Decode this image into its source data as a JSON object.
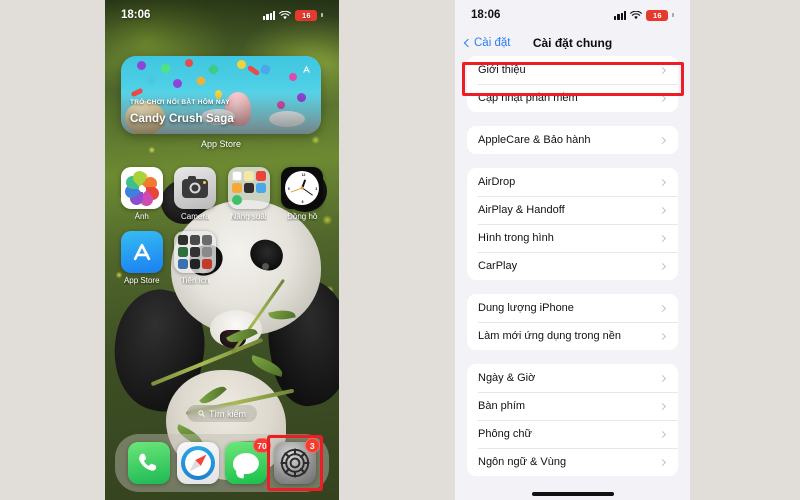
{
  "left_phone": {
    "status_bar": {
      "time": "18:06",
      "battery": "16",
      "signal_icon": "cellular-bars-icon",
      "wifi_icon": "wifi-icon"
    },
    "widget": {
      "eyebrow": "TRÒ CHƠI NỔI BẬT HÔM NAY",
      "title": "Candy Crush Saga",
      "caption": "App Store",
      "store_icon": "app-store-icon"
    },
    "apps": [
      {
        "label": "Ảnh",
        "icon": "photos-icon"
      },
      {
        "label": "Camera",
        "icon": "camera-icon"
      },
      {
        "label": "Năng suất",
        "icon": "folder-icon"
      },
      {
        "label": "Đồng hồ",
        "icon": "clock-icon"
      },
      {
        "label": "App Store",
        "icon": "app-store-icon"
      },
      {
        "label": "Tiện ích",
        "icon": "folder-icon"
      }
    ],
    "search": {
      "label": "Tìm kiếm",
      "icon": "search-icon"
    },
    "dock": [
      {
        "name": "phone",
        "icon": "phone-icon",
        "badge": ""
      },
      {
        "name": "safari",
        "icon": "safari-icon",
        "badge": ""
      },
      {
        "name": "messages",
        "icon": "messages-icon",
        "badge": "70"
      },
      {
        "name": "settings",
        "icon": "settings-gear-icon",
        "badge": "3",
        "highlighted": true
      }
    ]
  },
  "right_phone": {
    "status_bar": {
      "time": "18:06",
      "battery": "16",
      "signal_icon": "cellular-bars-icon",
      "wifi_icon": "wifi-icon"
    },
    "nav": {
      "back_label": "Cài đặt",
      "back_icon": "chevron-left-icon",
      "title": "Cài đặt chung"
    },
    "groups": [
      {
        "rows": [
          {
            "label": "Giới thiệu",
            "highlighted": true
          },
          {
            "label": "Cập nhật phần mềm",
            "highlighted": false
          }
        ]
      },
      {
        "rows": [
          {
            "label": "AppleCare & Bảo hành",
            "highlighted": false
          }
        ]
      },
      {
        "rows": [
          {
            "label": "AirDrop",
            "highlighted": false
          },
          {
            "label": "AirPlay & Handoff",
            "highlighted": false
          },
          {
            "label": "Hình trong hình",
            "highlighted": false
          },
          {
            "label": "CarPlay",
            "highlighted": false
          }
        ]
      },
      {
        "rows": [
          {
            "label": "Dung lượng iPhone",
            "highlighted": false
          },
          {
            "label": "Làm mới ứng dụng trong nền",
            "highlighted": false
          }
        ]
      },
      {
        "rows": [
          {
            "label": "Ngày & Giờ",
            "highlighted": false
          },
          {
            "label": "Bàn phím",
            "highlighted": false
          },
          {
            "label": "Phông chữ",
            "highlighted": false
          },
          {
            "label": "Ngôn ngữ & Vùng",
            "highlighted": false
          }
        ]
      }
    ]
  },
  "colors": {
    "accent_blue": "#2b7ef0",
    "highlight_red": "#ee1c25",
    "badge_red": "#f43b2e",
    "list_bg": "#f2f2f7",
    "page_bg": "#e1ded9"
  }
}
